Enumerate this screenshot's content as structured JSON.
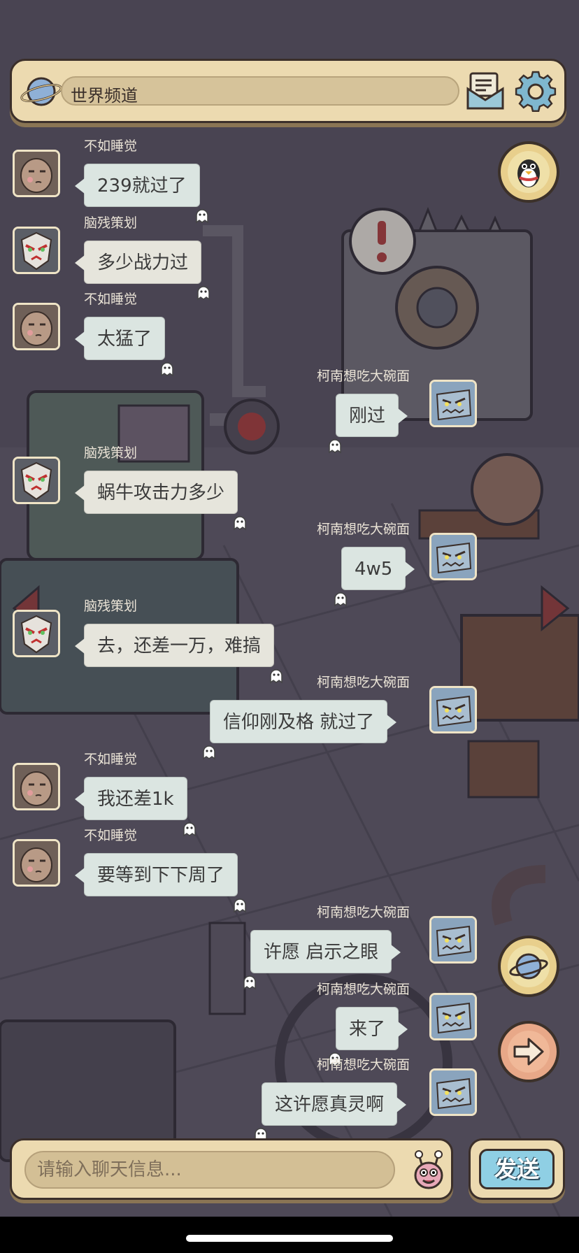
{
  "header": {
    "title": "世界频道"
  },
  "messages": [
    {
      "side": "left",
      "user": "不如睡觉",
      "text": "239就过了",
      "avatar": "potato"
    },
    {
      "side": "left",
      "user": "脑残策划",
      "text": "多少战力过",
      "avatar": "mask"
    },
    {
      "side": "left",
      "user": "不如睡觉",
      "text": "太猛了",
      "avatar": "potato"
    },
    {
      "side": "right",
      "user": "柯南想吃大碗面",
      "text": "刚过",
      "avatar": "robot"
    },
    {
      "side": "left",
      "user": "脑残策划",
      "text": "蜗牛攻击力多少",
      "avatar": "mask"
    },
    {
      "side": "right",
      "user": "柯南想吃大碗面",
      "text": "4w5",
      "avatar": "robot"
    },
    {
      "side": "left",
      "user": "脑残策划",
      "text": "去，还差一万，难搞",
      "avatar": "mask"
    },
    {
      "side": "right",
      "user": "柯南想吃大碗面",
      "text": "信仰刚及格  就过了",
      "avatar": "robot"
    },
    {
      "side": "left",
      "user": "不如睡觉",
      "text": "我还差1k",
      "avatar": "potato"
    },
    {
      "side": "left",
      "user": "不如睡觉",
      "text": "要等到下下周了",
      "avatar": "potato"
    },
    {
      "side": "right",
      "user": "柯南想吃大碗面",
      "text": "许愿  启示之眼",
      "avatar": "robot"
    },
    {
      "side": "right",
      "user": "柯南想吃大碗面",
      "text": "来了",
      "avatar": "robot"
    },
    {
      "side": "right",
      "user": "柯南想吃大碗面",
      "text": "这许愿真灵啊",
      "avatar": "robot"
    }
  ],
  "input": {
    "placeholder": "请输入聊天信息...",
    "value": ""
  },
  "send_label": "发送",
  "colors": {
    "panel": "#ecdab0",
    "bubble": "#dbe5e1",
    "outline": "#3b2f2a",
    "send": "#8fcfe4"
  }
}
